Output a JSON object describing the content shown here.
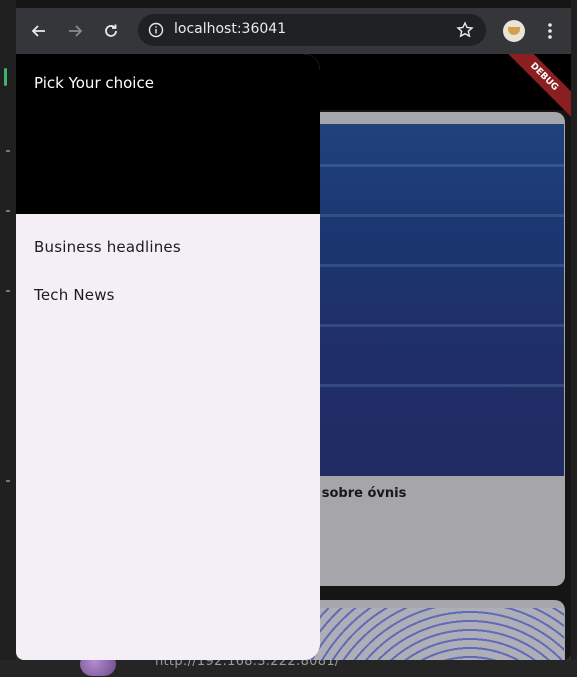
{
  "browser": {
    "url": "localhost:36041",
    "nav": {
      "back": "arrow-left-icon",
      "forward": "arrow-right-icon",
      "reload": "reload-icon",
      "info": "info-icon",
      "bookmark": "star-icon",
      "menu": "kebab-menu-icon"
    }
  },
  "app": {
    "debug_banner": "DEBUG",
    "drawer": {
      "title": "Pick Your choice",
      "items": [
        {
          "label": "Business headlines"
        },
        {
          "label": "Tech News"
        }
      ]
    },
    "article": {
      "title_visible": "gia Elon Musk e fala sobre óvnis"
    }
  },
  "desktop": {
    "bottom_url": "http://192.168.3.222:8081/"
  },
  "colors": {
    "drawer_bg": "#f4eff6",
    "header_bg": "#000000",
    "debug_banner": "#8a1f22",
    "browser_toolbar": "#35363a"
  }
}
